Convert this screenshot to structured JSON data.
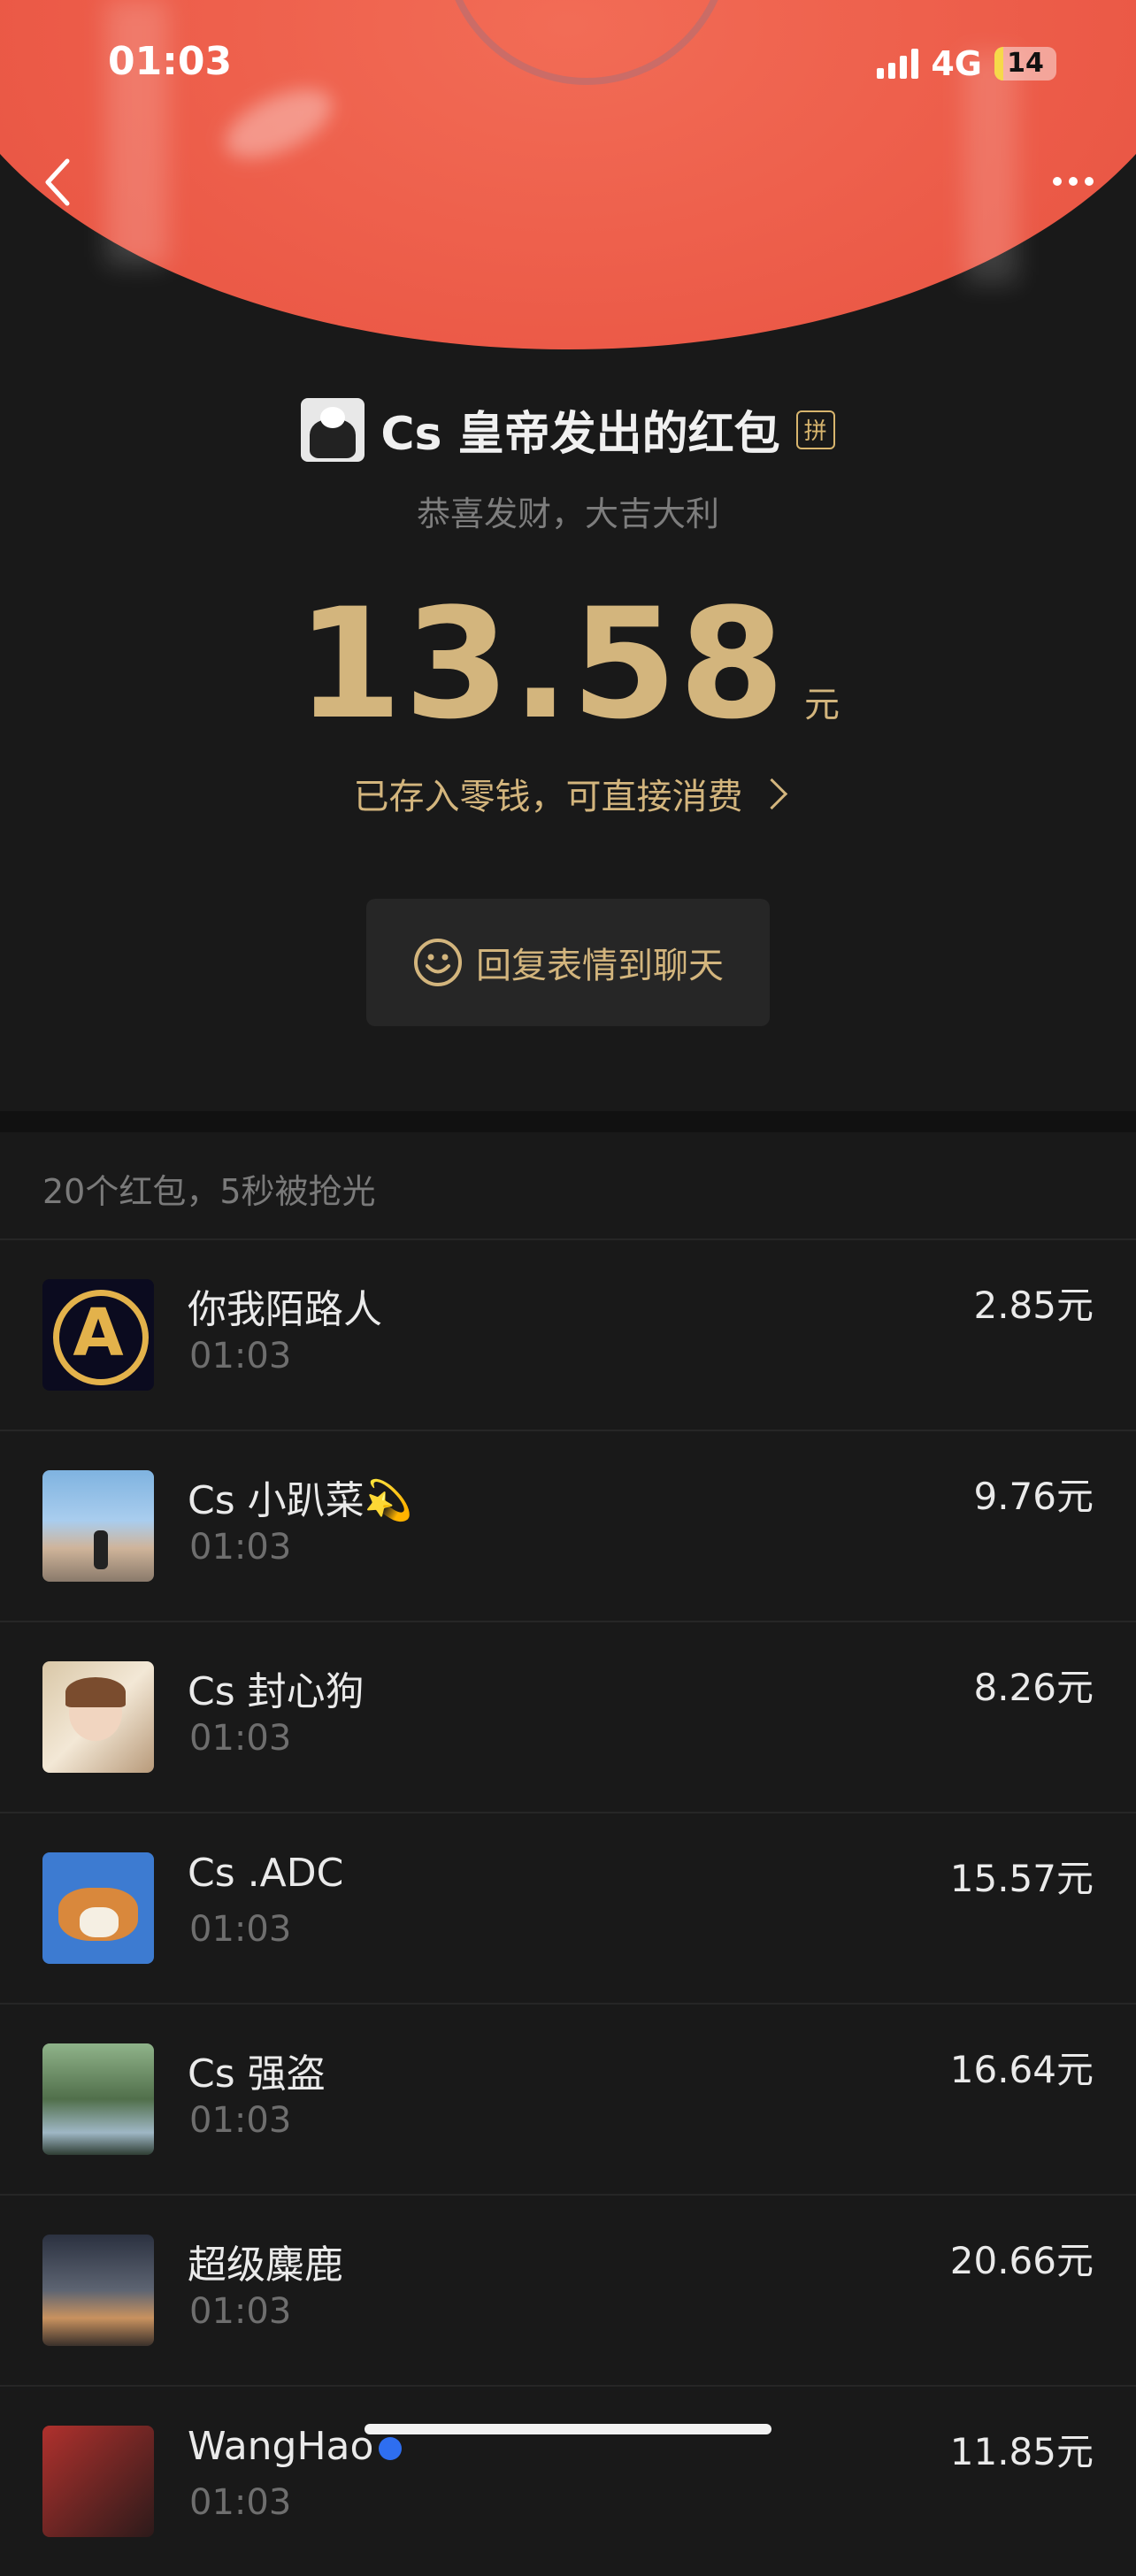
{
  "status_bar": {
    "time": "01:03",
    "network": "4G",
    "battery": "14",
    "battery_level_fraction": 0.14
  },
  "nav": {
    "back_icon": "chevron-left-icon",
    "more_icon": "ellipsis-icon"
  },
  "packet": {
    "sender_title": "Cs 皇帝发出的红包",
    "pin_badge": "拼",
    "wish": "恭喜发财，大吉大利",
    "amount": "13.58",
    "amount_unit": "元",
    "deposit_text": "已存入零钱，可直接消费"
  },
  "reply_button": {
    "label": "回复表情到聊天",
    "icon": "smile-icon"
  },
  "summary": "20个红包，5秒被抢光",
  "receivers": [
    {
      "name": "你我陌路人",
      "time": "01:03",
      "amount": "2.85元"
    },
    {
      "name": "Cs 小趴菜💫",
      "time": "01:03",
      "amount": "9.76元"
    },
    {
      "name": "Cs  封心狗",
      "time": "01:03",
      "amount": "8.26元"
    },
    {
      "name": "Cs .ADC",
      "time": "01:03",
      "amount": "15.57元"
    },
    {
      "name": "Cs 强盗",
      "time": "01:03",
      "amount": "16.64元"
    },
    {
      "name": "超级麋鹿",
      "time": "01:03",
      "amount": "20.66元"
    },
    {
      "name": "WangHao",
      "time": "01:03",
      "amount": "11.85元"
    }
  ],
  "colors": {
    "gold": "#d3b57d",
    "background": "#191919",
    "red": "#ec5b48"
  }
}
